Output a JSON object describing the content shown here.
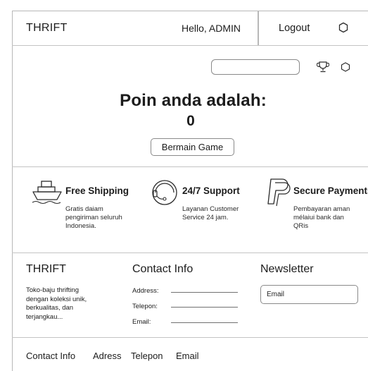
{
  "header": {
    "brand": "THRIFT",
    "greeting": "Hello, ADMIN",
    "logout_label": "Logout"
  },
  "hero": {
    "search_value": "",
    "title": "Poin anda adalah:",
    "points": "0",
    "play_button": "Bermain Game"
  },
  "features": [
    {
      "title": "Free Shipping",
      "icon": "ship-icon",
      "description": [
        "Gratis daiam",
        "pengiriman seluruh",
        "Indonesia."
      ]
    },
    {
      "title": "24/7 Support",
      "icon": "headset-icon",
      "description": [
        "Layanan Customer",
        "Service 24 jam."
      ]
    },
    {
      "title": "Secure Payments",
      "icon": "paypal-icon",
      "description": [
        "Pembayaran aman",
        "mélaiui bank dan",
        "QRis"
      ]
    }
  ],
  "footer": {
    "brand": "THRIFT",
    "description_lines": [
      "Toko-baju thrifting",
      "dengan koleksi unik,",
      "berkualitas, dan",
      "terjangkau..."
    ],
    "contact_title": "Contact Info",
    "contact_fields": [
      "Address:",
      "Telepon:",
      "Email:"
    ],
    "newsletter_title": "Newsletter",
    "newsletter_placeholder": "Email"
  },
  "bottom_links": [
    "Contact Info",
    "Adress",
    "Telepon",
    "Email"
  ]
}
